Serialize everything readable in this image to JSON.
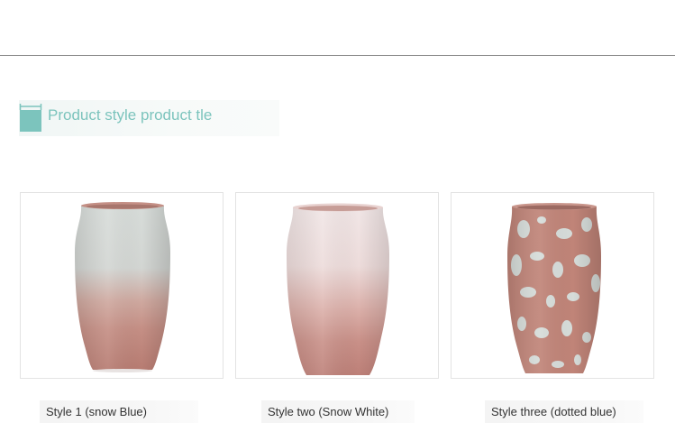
{
  "section": {
    "title": "Product style product tle",
    "accent_color": "#7cc4bd",
    "icon": "bookmark-icon"
  },
  "products": [
    {
      "caption": "Style 1 (snow Blue)"
    },
    {
      "caption": "Style two (Snow White)"
    },
    {
      "caption": "Style three (dotted blue)"
    }
  ]
}
